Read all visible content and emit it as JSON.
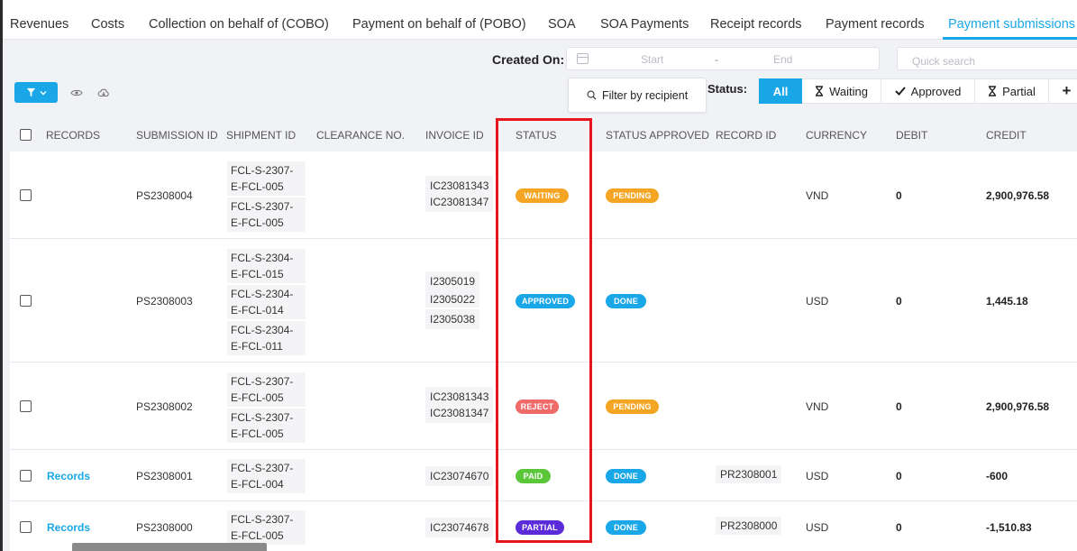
{
  "tabs": [
    {
      "label": "Revenues",
      "active": false
    },
    {
      "label": "Costs",
      "active": false
    },
    {
      "label": "Collection on behalf of (COBO)",
      "active": false
    },
    {
      "label": "Payment on behalf of (POBO)",
      "active": false
    },
    {
      "label": "SOA",
      "active": false
    },
    {
      "label": "SOA Payments",
      "active": false
    },
    {
      "label": "Receipt records",
      "active": false
    },
    {
      "label": "Payment records",
      "active": false
    },
    {
      "label": "Payment submissions",
      "active": true
    }
  ],
  "toolbar": {
    "created_on_label": "Created On:",
    "date_start_placeholder": "Start",
    "date_separator": "-",
    "date_end_placeholder": "End",
    "quick_search_placeholder": "Quick search",
    "filter_by_recipient": "Filter by recipient",
    "status_label": "Status:",
    "status_filters": [
      {
        "label": "All",
        "icon": "none",
        "selected": true
      },
      {
        "label": "Waiting",
        "icon": "hourglass-icon",
        "selected": false
      },
      {
        "label": "Approved",
        "icon": "check-icon",
        "selected": false
      },
      {
        "label": "Partial",
        "icon": "hourglass-icon",
        "selected": false
      }
    ],
    "more_filters_label": "+"
  },
  "table": {
    "columns": [
      "RECORDS",
      "SUBMISSION ID",
      "SHIPMENT ID",
      "CLEARANCE NO.",
      "INVOICE ID",
      "STATUS",
      "STATUS APPROVED",
      "RECORD ID",
      "CURRENCY",
      "DEBIT",
      "CREDIT"
    ],
    "rows": [
      {
        "records": "",
        "submission_id": "PS2308004",
        "shipment_ids": [
          "FCL-S-2307-E-FCL-005",
          "FCL-S-2307-E-FCL-005"
        ],
        "clearance_no": "",
        "invoice_ids": [
          "IC23081343",
          "IC23081347"
        ],
        "status": "WAITING",
        "status_approved": "PENDING",
        "record_id": "",
        "currency": "VND",
        "debit": "0",
        "credit": "2,900,976.58"
      },
      {
        "records": "",
        "submission_id": "PS2308003",
        "shipment_ids": [
          "FCL-S-2304-E-FCL-015",
          "FCL-S-2304-E-FCL-014",
          "FCL-S-2304-E-FCL-011"
        ],
        "clearance_no": "",
        "invoice_ids": [
          "I2305019",
          "I2305022",
          "I2305038"
        ],
        "status": "APPROVED",
        "status_approved": "DONE",
        "record_id": "",
        "currency": "USD",
        "debit": "0",
        "credit": "1,445.18"
      },
      {
        "records": "",
        "submission_id": "PS2308002",
        "shipment_ids": [
          "FCL-S-2307-E-FCL-005",
          "FCL-S-2307-E-FCL-005"
        ],
        "clearance_no": "",
        "invoice_ids": [
          "IC23081343",
          "IC23081347"
        ],
        "status": "REJECT",
        "status_approved": "PENDING",
        "record_id": "",
        "currency": "VND",
        "debit": "0",
        "credit": "2,900,976.58"
      },
      {
        "records": "Records",
        "submission_id": "PS2308001",
        "shipment_ids": [
          "FCL-S-2307-E-FCL-004"
        ],
        "clearance_no": "",
        "invoice_ids": [
          "IC23074670"
        ],
        "status": "PAID",
        "status_approved": "DONE",
        "record_id": "PR2308001",
        "currency": "USD",
        "debit": "0",
        "credit": "-600"
      },
      {
        "records": "Records",
        "submission_id": "PS2308000",
        "shipment_ids": [
          "FCL-S-2307-E-FCL-005"
        ],
        "clearance_no": "",
        "invoice_ids": [
          "IC23074678"
        ],
        "status": "PARTIAL",
        "status_approved": "DONE",
        "record_id": "PR2308000",
        "currency": "USD",
        "debit": "0",
        "credit": "-1,510.83"
      }
    ]
  },
  "badge_colors": {
    "WAITING": "#f5a524",
    "PENDING": "#f5a524",
    "APPROVED": "#1aa7e8",
    "DONE": "#1aa7e8",
    "REJECT": "#f06a6a",
    "PAID": "#5cc63a",
    "PARTIAL": "#5b2bd9"
  },
  "accent_color": "#1aa7e8",
  "highlight_color": "#e8141c"
}
